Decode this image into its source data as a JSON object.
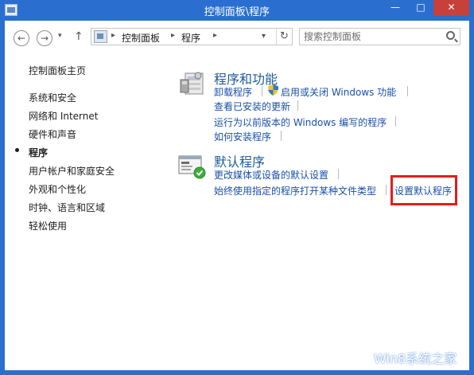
{
  "window": {
    "title": "控制面板\\程序",
    "min_label": "—",
    "max_label": "□",
    "close_label": "✕"
  },
  "nav": {
    "back_label": "←",
    "forward_label": "→",
    "history_label": "▾",
    "up_label": "↑",
    "breadcrumb": [
      "控制面板",
      "程序"
    ],
    "sep_label": "▸",
    "dropdown_label": "▾",
    "refresh_label": "↻"
  },
  "search": {
    "placeholder": "搜索控制面板"
  },
  "sidebar": {
    "items": [
      {
        "label": "控制面板主页"
      },
      {
        "label": "系统和安全"
      },
      {
        "label": "网络和 Internet"
      },
      {
        "label": "硬件和声音"
      },
      {
        "label": "程序"
      },
      {
        "label": "用户帐户和家庭安全"
      },
      {
        "label": "外观和个性化"
      },
      {
        "label": "时钟、语言和区域"
      },
      {
        "label": "轻松使用"
      }
    ],
    "current": "程序"
  },
  "sections": [
    {
      "title": "程序和功能",
      "icon": "programs-features-icon",
      "links": [
        "卸载程序",
        "启用或关闭 Windows 功能",
        "查看已安装的更新",
        "运行为以前版本的 Windows 编写的程序",
        "如何安装程序"
      ]
    },
    {
      "title": "默认程序",
      "icon": "default-programs-icon",
      "links": [
        "更改媒体或设备的默认设置",
        "始终使用指定的程序打开某种文件类型",
        "设置默认程序"
      ]
    }
  ],
  "watermark": {
    "text": "Win8系统之家"
  },
  "colors": {
    "titlebar": "#2a6fd0",
    "link": "#1a4fa8",
    "category_title": "#1e5a9a",
    "highlight_border": "#e31d1d",
    "close_button": "#c7403a"
  }
}
